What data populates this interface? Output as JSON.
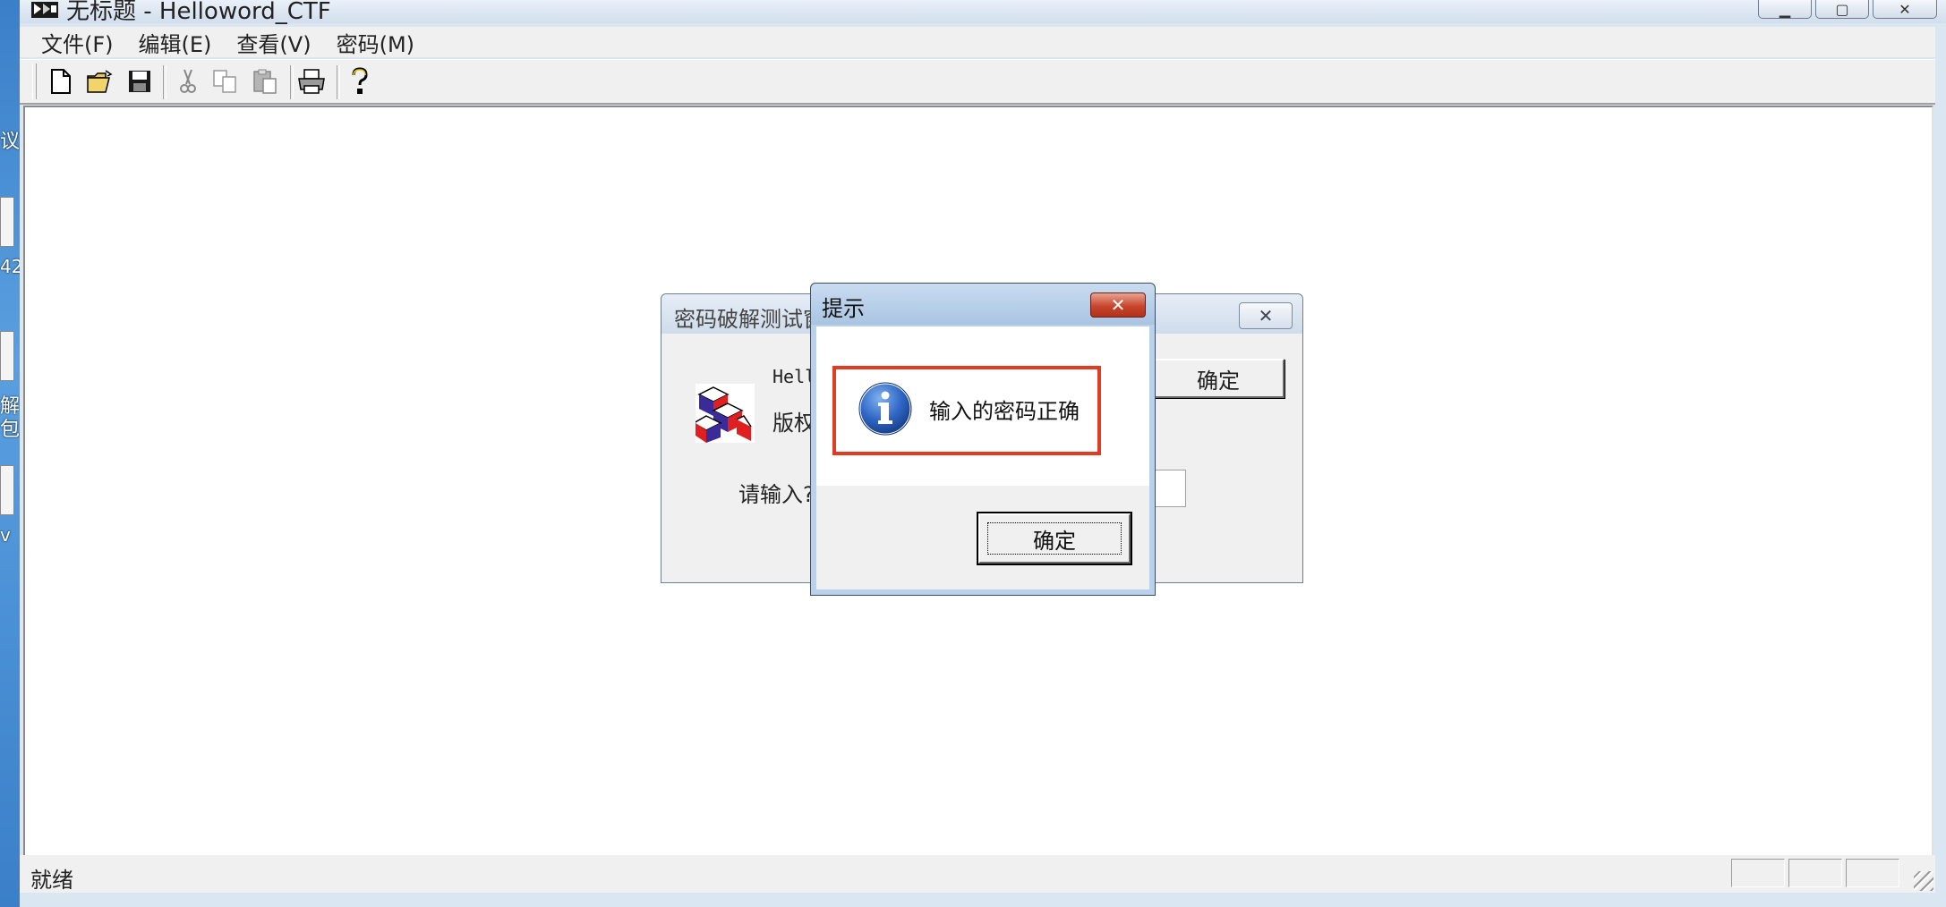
{
  "window": {
    "title": "无标题 - Helloword_CTF",
    "caption_buttons": {
      "minimize": "▁",
      "maximize": "▢",
      "close": "✕"
    }
  },
  "menu": {
    "items": [
      "文件(F)",
      "编辑(E)",
      "查看(V)",
      "密码(M)"
    ]
  },
  "toolbar": {
    "buttons": [
      "new-file-icon",
      "open-folder-icon",
      "save-icon",
      "cut-icon",
      "copy-icon",
      "paste-icon",
      "print-icon",
      "help-icon"
    ]
  },
  "status": {
    "text": "就绪"
  },
  "desktop": {
    "fragments": [
      "议",
      "42",
      "解",
      "包",
      "v"
    ]
  },
  "background_dialog": {
    "title": "密码破解测试窗",
    "close_glyph": "✕",
    "hello_text": "Hell",
    "copyright_text": "版权",
    "prompt_text": "请输入?",
    "ok_label": "确定"
  },
  "message_box": {
    "title": "提示",
    "close_glyph": "✕",
    "message": "输入的密码正确",
    "ok_label": "确定",
    "icon": "info-icon"
  },
  "colors": {
    "highlight_border": "#e03c24",
    "close_button": "#c8452c",
    "title_gradient_top": "#c9dcf0"
  }
}
